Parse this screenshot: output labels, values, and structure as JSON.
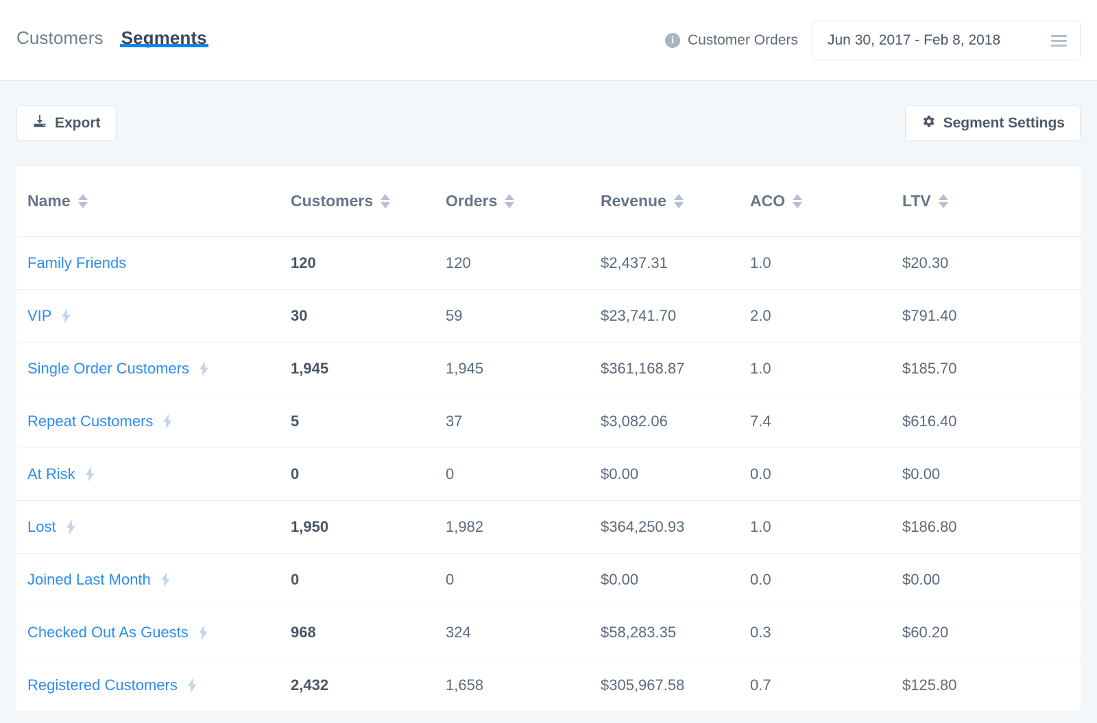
{
  "header": {
    "tabs": [
      {
        "label": "Customers",
        "active": false
      },
      {
        "label": "Segments",
        "active": true
      }
    ],
    "info_icon": "info-icon",
    "orders_label": "Customer Orders",
    "date_range": "Jun 30, 2017 - Feb 8, 2018",
    "menu_icon": "hamburger-icon"
  },
  "toolbar": {
    "export_label": "Export",
    "export_icon": "download-icon",
    "settings_label": "Segment Settings",
    "settings_icon": "gear-icon"
  },
  "table": {
    "columns": [
      {
        "label": "Name"
      },
      {
        "label": "Customers"
      },
      {
        "label": "Orders"
      },
      {
        "label": "Revenue"
      },
      {
        "label": "ACO"
      },
      {
        "label": "LTV"
      }
    ],
    "rows": [
      {
        "name": "Family Friends",
        "bolt": false,
        "customers": "120",
        "orders": "120",
        "revenue": "$2,437.31",
        "aco": "1.0",
        "ltv": "$20.30"
      },
      {
        "name": "VIP",
        "bolt": true,
        "customers": "30",
        "orders": "59",
        "revenue": "$23,741.70",
        "aco": "2.0",
        "ltv": "$791.40"
      },
      {
        "name": "Single Order Customers",
        "bolt": true,
        "customers": "1,945",
        "orders": "1,945",
        "revenue": "$361,168.87",
        "aco": "1.0",
        "ltv": "$185.70"
      },
      {
        "name": "Repeat Customers",
        "bolt": true,
        "customers": "5",
        "orders": "37",
        "revenue": "$3,082.06",
        "aco": "7.4",
        "ltv": "$616.40"
      },
      {
        "name": "At Risk",
        "bolt": true,
        "customers": "0",
        "orders": "0",
        "revenue": "$0.00",
        "aco": "0.0",
        "ltv": "$0.00"
      },
      {
        "name": "Lost",
        "bolt": true,
        "customers": "1,950",
        "orders": "1,982",
        "revenue": "$364,250.93",
        "aco": "1.0",
        "ltv": "$186.80"
      },
      {
        "name": "Joined Last Month",
        "bolt": true,
        "customers": "0",
        "orders": "0",
        "revenue": "$0.00",
        "aco": "0.0",
        "ltv": "$0.00"
      },
      {
        "name": "Checked Out As Guests",
        "bolt": true,
        "customers": "968",
        "orders": "324",
        "revenue": "$58,283.35",
        "aco": "0.3",
        "ltv": "$60.20"
      },
      {
        "name": "Registered Customers",
        "bolt": true,
        "customers": "2,432",
        "orders": "1,658",
        "revenue": "$305,967.58",
        "aco": "0.7",
        "ltv": "$125.80"
      }
    ]
  },
  "colors": {
    "accent": "#0d86ee",
    "link": "#2d8cf0",
    "page_bg": "#f4f7f9",
    "card_bg": "#ffffff",
    "bolt": "#c2d4e8",
    "sort": "#b6c0cf"
  }
}
